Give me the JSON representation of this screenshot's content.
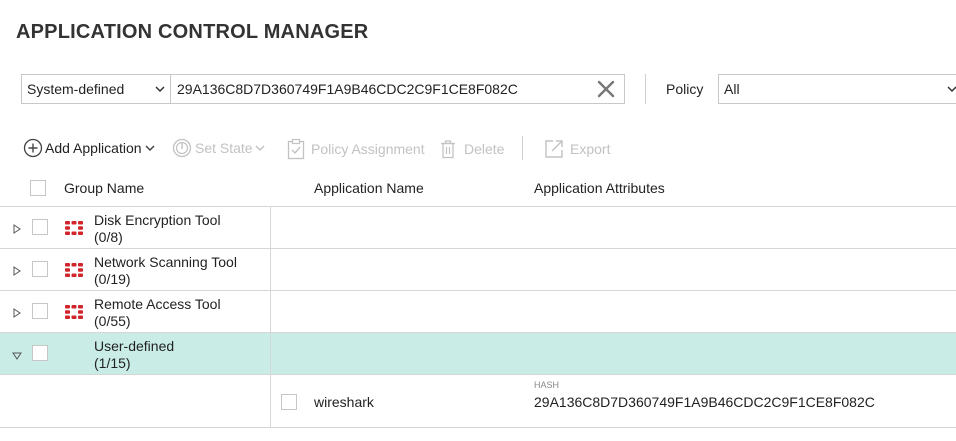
{
  "page": {
    "title": "APPLICATION CONTROL MANAGER"
  },
  "filters": {
    "source_select": "System-defined",
    "search_value": "29A136C8D7D360749F1A9B46CDC2C9F1CE8F082C",
    "policy_label": "Policy",
    "policy_select": "All"
  },
  "toolbar": {
    "add_application": "Add Application",
    "set_state": "Set State",
    "policy_assignment": "Policy Assignment",
    "delete": "Delete",
    "export": "Export"
  },
  "table": {
    "columns": {
      "group": "Group Name",
      "application": "Application Name",
      "attributes": "Application Attributes"
    },
    "groups": [
      {
        "name": "Disk Encryption Tool",
        "count": "(0/8)",
        "expanded": false,
        "selected": false
      },
      {
        "name": "Network Scanning Tool",
        "count": "(0/19)",
        "expanded": false,
        "selected": false
      },
      {
        "name": "Remote Access Tool",
        "count": "(0/55)",
        "expanded": false,
        "selected": false
      },
      {
        "name": "User-defined",
        "count": "(1/15)",
        "expanded": true,
        "selected": true
      }
    ],
    "child_rows": [
      {
        "application": "wireshark",
        "attr_key": "HASH",
        "attr_value": "29A136C8D7D360749F1A9B46CDC2C9F1CE8F082C"
      }
    ]
  },
  "colors": {
    "selected_row": "#c9ede6",
    "fortinet_red": "#d0262b",
    "disabled_text": "#c2c2c2"
  }
}
